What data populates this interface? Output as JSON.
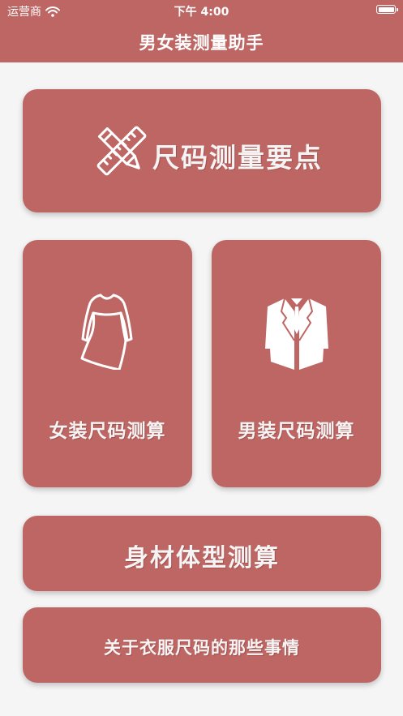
{
  "status_bar": {
    "carrier": "运营商",
    "time": "下午 4:00"
  },
  "nav": {
    "title": "男女装测量助手"
  },
  "menu": {
    "tips": {
      "label": "尺码测量要点",
      "icon": "pencil-ruler-icon"
    },
    "women": {
      "label": "女装尺码测算",
      "icon": "dress-icon"
    },
    "men": {
      "label": "男装尺码测算",
      "icon": "suit-icon"
    },
    "body": {
      "label": "身材体型测算"
    },
    "about": {
      "label": "关于衣服尺码的那些事情"
    }
  },
  "colors": {
    "accent": "#bd6663",
    "background": "#f5f5f5",
    "text": "#f4f4f4"
  }
}
